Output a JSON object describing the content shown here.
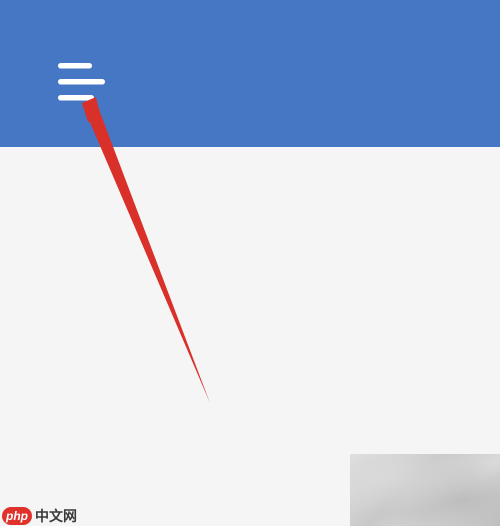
{
  "header": {
    "background_color": "#4677c5",
    "menu_icon": "hamburger-menu-icon"
  },
  "content": {
    "background_color": "#f5f5f6"
  },
  "annotation": {
    "arrow_color": "#d9302a",
    "points_to": "hamburger-menu-icon"
  },
  "watermark": {
    "logo": "php",
    "site": "中文网"
  }
}
